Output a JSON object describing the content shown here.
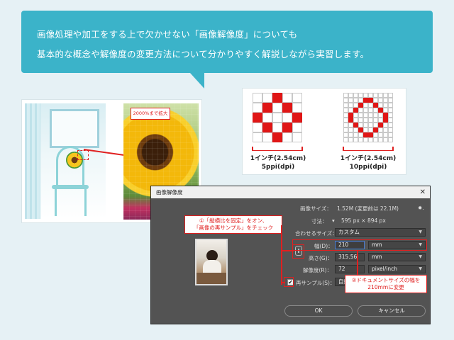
{
  "banner": {
    "line1": "画像処理や加工をする上で欠かせない「画像解像度」についても",
    "line2": "基本的な概念や解像度の変更方法について分かりやすく解説しながら実習します。"
  },
  "zoom_label": "2000%まで拡大",
  "grids": {
    "left": {
      "caption1": "1インチ(2.54cm)",
      "caption2": "5ppi(dpi)"
    },
    "right": {
      "caption1": "1インチ(2.54cm)",
      "caption2": "10ppi(dpi)"
    }
  },
  "dialog": {
    "title": "画像解像度",
    "close": "✕",
    "image_size_label": "画像サイズ：",
    "image_size_value": "1.52M (変更前は 22.1M)",
    "gear": "✹.",
    "dimensions_label": "寸法：",
    "dimensions_value": "595 px × 894 px",
    "fit_label": "合わせるサイズ：",
    "fit_value": "カスタム",
    "width_label": "幅(D)：",
    "width_value": "210",
    "width_unit": "mm",
    "height_label": "高さ(G)：",
    "height_value": "315.56",
    "height_unit": "mm",
    "resolution_label": "解像度(R)：",
    "resolution_value": "72",
    "resolution_unit": "pixel/inch",
    "resample_label": "再サンプル(S)：",
    "resample_value": "自動",
    "resample_checked": true,
    "ok": "OK",
    "cancel": "キャンセル"
  },
  "callouts": {
    "left_line1": "①「縦横比を固定」をオン、",
    "left_line2": "「画像の再サンプル」をチェック",
    "right_line1": "②ドキュメントサイズの幅を",
    "right_line2": "210mmに変更"
  },
  "colors": {
    "banner": "#3bb3c9",
    "accent_red": "#e02020",
    "dialog_bg": "#535353"
  }
}
